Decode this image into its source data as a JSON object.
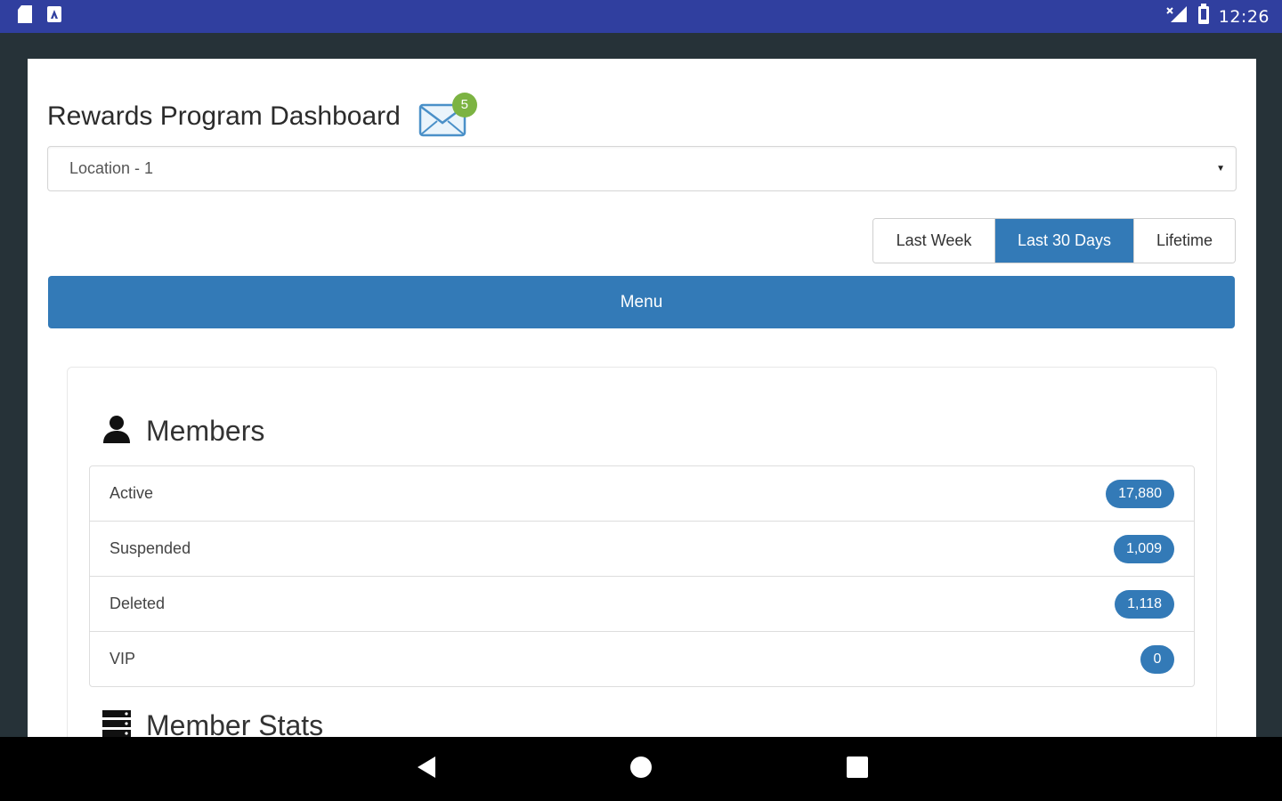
{
  "status_bar": {
    "time": "12:26",
    "left_icons": [
      "sd-card-icon",
      "app-notification-icon"
    ],
    "right_icons": [
      "signal-icon",
      "battery-icon"
    ]
  },
  "header": {
    "title": "Rewards Program Dashboard",
    "mail_badge_count": "5"
  },
  "location_select": {
    "selected": "Location - 1"
  },
  "date_range": {
    "options": [
      {
        "label": "Last Week",
        "active": false
      },
      {
        "label": "Last 30 Days",
        "active": true
      },
      {
        "label": "Lifetime",
        "active": false
      }
    ]
  },
  "menu_button": {
    "label": "Menu"
  },
  "members": {
    "title": "Members",
    "items": [
      {
        "label": "Active",
        "count": "17,880"
      },
      {
        "label": "Suspended",
        "count": "1,009"
      },
      {
        "label": "Deleted",
        "count": "1,118"
      },
      {
        "label": "VIP",
        "count": "0"
      }
    ]
  },
  "member_stats": {
    "title": "Member Stats"
  },
  "colors": {
    "status_bar": "#303f9f",
    "primary": "#337ab7",
    "badge_green": "#7cb342",
    "app_background": "#263238"
  }
}
